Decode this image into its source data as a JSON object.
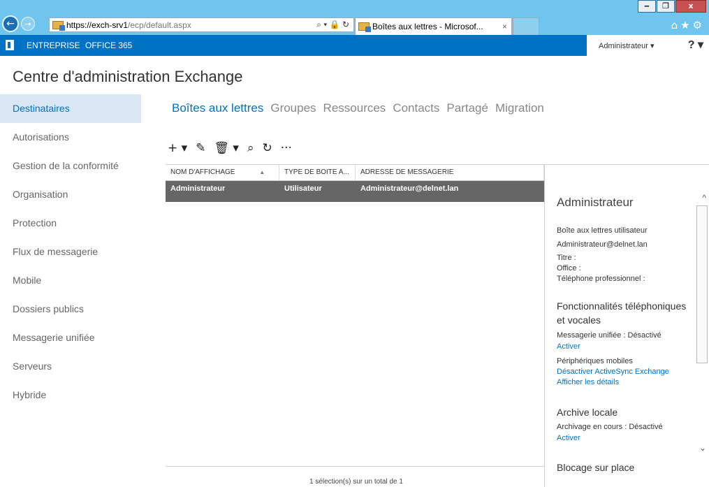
{
  "browser": {
    "window_buttons": [
      "‒",
      "❐",
      "x"
    ],
    "url_host": "https://exch-srv1",
    "url_path": "/ecp/default.aspx",
    "address_tools": "⌕ ▾ 🔒 ↻",
    "tab_title": "Boîtes aux lettres - Microsof...",
    "tab_close": "×",
    "chrome_icons": "⌂★⚙"
  },
  "office_bar": {
    "links": [
      "ENTREPRISE",
      "OFFICE 365"
    ],
    "user": "Administrateur",
    "user_caret": "▾",
    "help": "? ▾"
  },
  "page": {
    "title": "Centre d'administration Exchange"
  },
  "sidebar": {
    "items": [
      {
        "label": "Destinataires",
        "active": true
      },
      {
        "label": "Autorisations"
      },
      {
        "label": "Gestion de la conformité"
      },
      {
        "label": "Organisation"
      },
      {
        "label": "Protection"
      },
      {
        "label": "Flux de messagerie"
      },
      {
        "label": "Mobile"
      },
      {
        "label": "Dossiers publics"
      },
      {
        "label": "Messagerie unifiée"
      },
      {
        "label": "Serveurs"
      },
      {
        "label": "Hybride"
      }
    ]
  },
  "tabs": [
    "Boîtes aux lettres",
    "Groupes",
    "Ressources",
    "Contacts",
    "Partagé",
    "Migration"
  ],
  "toolbar": {
    "add": "+ ▾",
    "edit": "✎",
    "delete": "🗑 ▾",
    "search": "⌕",
    "refresh": "↻",
    "more": "···"
  },
  "grid": {
    "headers": [
      "NOM D'AFFICHAGE",
      "TYPE DE BOITE A...",
      "ADRESSE DE MESSAGERIE"
    ],
    "sort_indicator": "▲",
    "rows": [
      [
        "Administrateur",
        "Utilisateur",
        "Administrateur@delnet.lan"
      ]
    ],
    "footer": "1 sélection(s) sur un total de 1"
  },
  "details": {
    "name": "Administrateur",
    "mailbox_type": "Boîte aux lettres utilisateur",
    "email": "Administrateur@delnet.lan",
    "title_label": "Titre :",
    "office_label": "Office :",
    "phone_label": "Téléphone professionnel :",
    "phone_features_heading": "Fonctionnalités téléphoniques et vocales",
    "um_status": "Messagerie unifiée : Désactivé",
    "um_enable": "Activer",
    "mobile_devices": "Périphériques mobiles",
    "disable_activesync": "Désactiver ActiveSync Exchange",
    "show_details": "Afficher les détails",
    "archive_heading": "Archive locale",
    "archive_status": "Archivage en cours : Désactivé",
    "archive_enable": "Activer",
    "hold_heading": "Blocage sur place",
    "scroll_up": "^",
    "scroll_down": "⌄"
  }
}
